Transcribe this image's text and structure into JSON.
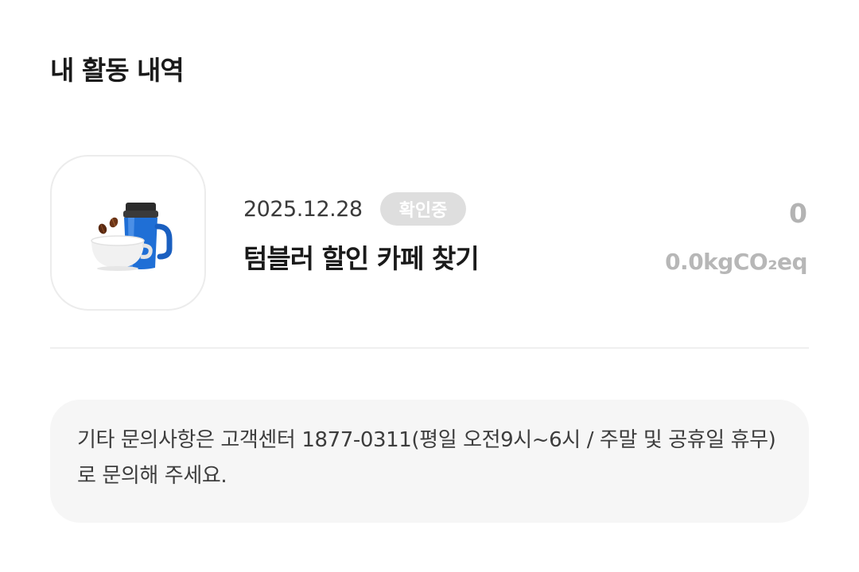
{
  "section": {
    "title": "내 활동 내역"
  },
  "activity": {
    "date": "2025.12.28",
    "status": "확인중",
    "title": "텀블러 할인 카페 찾기",
    "points": "0",
    "carbon": "0.0kgCO₂eq",
    "icon": "tumbler-coffee-icon"
  },
  "notice": {
    "text": "기타 문의사항은 고객센터 1877-0311(평일 오전9시~6시 / 주말 및 공휴일 휴무)로 문의해 주세요."
  },
  "colors": {
    "badge_bg": "#dedede",
    "notice_bg": "#f6f6f6",
    "muted_text": "#b3b3b3",
    "tumbler_blue": "#1f6fd6"
  }
}
